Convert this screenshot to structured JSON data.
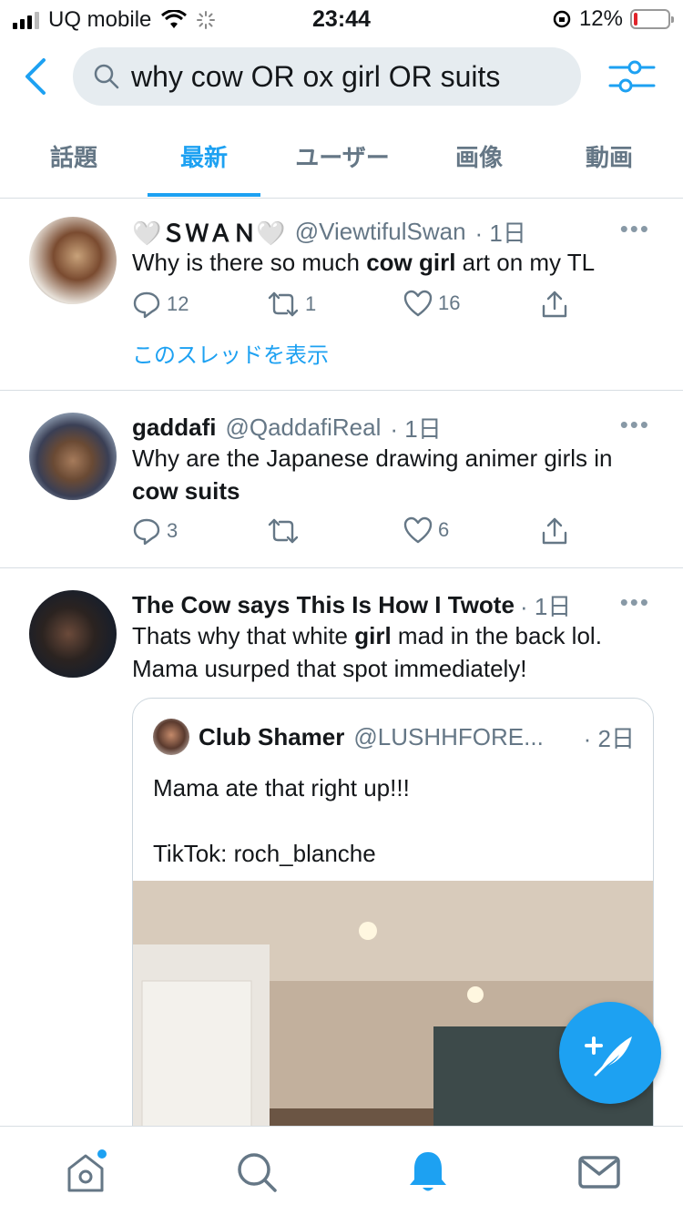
{
  "status": {
    "carrier": "UQ mobile",
    "time": "23:44",
    "battery": "12%",
    "battery_level": 0.12
  },
  "search": {
    "query": "why cow OR ox girl OR suits"
  },
  "tabs": [
    {
      "label": "話題",
      "active": false
    },
    {
      "label": "最新",
      "active": true
    },
    {
      "label": "ユーザー",
      "active": false
    },
    {
      "label": "画像",
      "active": false
    },
    {
      "label": "動画",
      "active": false
    }
  ],
  "tweets": [
    {
      "name": "🤍ＳＷＡＮ🤍",
      "handle": "@ViewtifulSwan",
      "time": "· 1日",
      "text_parts": [
        "Why is there so much ",
        "cow girl",
        " art on my TL"
      ],
      "replies": "12",
      "retweets": "1",
      "likes": "16",
      "thread_link": "このスレッドを表示"
    },
    {
      "name": "gaddafi",
      "handle": "@QaddafiReal",
      "time": "· 1日",
      "text_parts": [
        "Why are the Japanese drawing animer girls in ",
        "cow suits"
      ],
      "replies": "3",
      "retweets": "",
      "likes": "6"
    },
    {
      "name": "The Cow says This Is How I Twote",
      "handle": "",
      "time": "· 1日",
      "text_parts": [
        "Thats why that white ",
        "girl",
        " mad in the back lol.  Mama usurped that spot immediately!"
      ],
      "quote": {
        "name": "Club Shamer",
        "handle": "@LUSHHFORE...",
        "time": "· 2日",
        "line1": "Mama ate that right up!!!",
        "line2": "TikTok: roch_blanche"
      }
    }
  ],
  "dots_label": "•••",
  "colors": {
    "accent": "#1da1f2",
    "muted": "#657786",
    "search_bg": "#e6ecf0",
    "battery_low": "#e0242b"
  },
  "icons": {
    "back": "chevron-left-icon",
    "filter": "sliders-icon",
    "reply": "comment-icon",
    "retweet": "retweet-icon",
    "like": "heart-icon",
    "share": "share-icon",
    "compose": "feather-plus-icon",
    "home": "home-icon",
    "search": "search-icon",
    "notifications": "bell-icon",
    "messages": "mail-icon"
  }
}
